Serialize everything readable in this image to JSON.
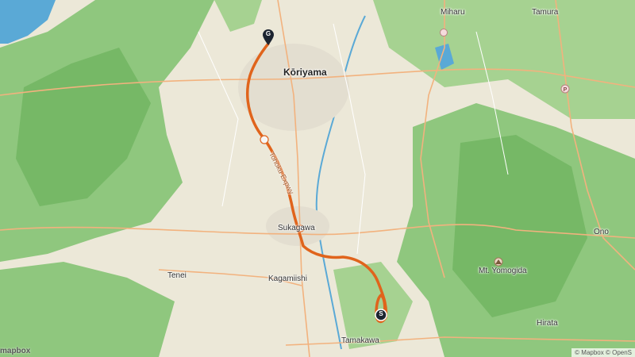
{
  "map": {
    "places": {
      "koriyama": "Kōriyama",
      "miharu": "Miharu",
      "tamura": "Tamura",
      "sukagawa": "Sukagawa",
      "kagamiishi": "Kagamiishi",
      "tenei": "Tenei",
      "tamakawa": "Tamakawa",
      "ono": "Ono",
      "hirata": "Hirata",
      "mt_yomogida": "Mt. Yomogida"
    },
    "road_label": "Tohoku Expwy",
    "markers": {
      "goal": "G",
      "start": "S"
    },
    "attribution": "© Mapbox © OpenS",
    "logo_text": "mapbox",
    "colors": {
      "land": "#ece8d8",
      "forest": "#8fc77e",
      "forest_dark": "#6bb25e",
      "water": "#5aa9d6",
      "route": "#e0641c",
      "marker": "#1c2430"
    },
    "icons": [
      "mountain-icon",
      "pin-icon",
      "parking-icon"
    ]
  }
}
